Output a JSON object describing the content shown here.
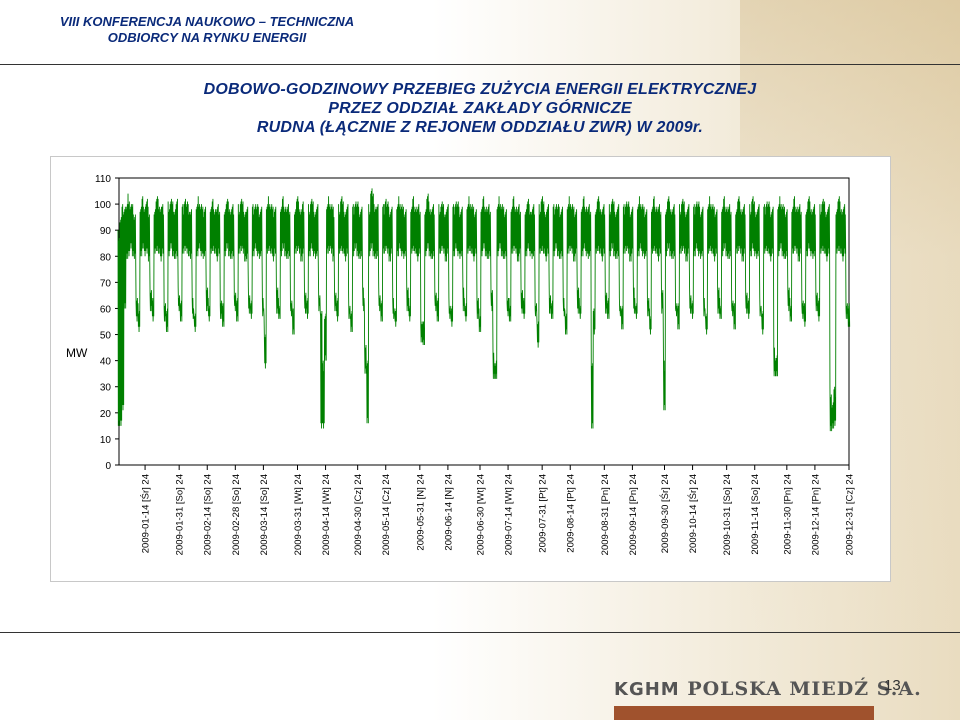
{
  "header": {
    "conference_line1": "VIII KONFERENCJA NAUKOWO – TECHNICZNA",
    "conference_line2": "ODBIORCY NA RYNKU ENERGII"
  },
  "slide_title": {
    "line1": "DOBOWO-GODZINOWY PRZEBIEG ZUŻYCIA ENERGII ELEKTRYCZNEJ",
    "line2": "PRZEZ ODDZIAŁ ZAKŁADY GÓRNICZE",
    "line3": "RUDNA (ŁĄCZNIE Z REJONEM ODDZIAŁU ZWR) W 2009r."
  },
  "footer": {
    "logo_kghm": "KGHM",
    "logo_rest": "POLSKA MIEDŹ S.A.",
    "page_number": "13"
  },
  "colors": {
    "title_blue": "#0a2a7a",
    "series_green": "#008000",
    "logo_bar": "#a0522d"
  },
  "chart_data": {
    "type": "line",
    "title": "",
    "xlabel": "",
    "ylabel": "MW",
    "ylim": [
      0,
      110
    ],
    "yticks": [
      0,
      10,
      20,
      30,
      40,
      50,
      60,
      70,
      80,
      90,
      100,
      110
    ],
    "grid": false,
    "series_color": "#008000",
    "x_tick_labels": [
      "2009-01-14 [Śr] 24",
      "2009-01-31 [So] 24",
      "2009-02-14 [So] 24",
      "2009-02-28 [So] 24",
      "2009-03-14 [So] 24",
      "2009-03-31 [Wt] 24",
      "2009-04-14 [Wt] 24",
      "2009-04-30 [Cz] 24",
      "2009-05-14 [Cz] 24",
      "2009-05-31 [N] 24",
      "2009-06-14 [N] 24",
      "2009-06-30 [Wt] 24",
      "2009-07-14 [Wt] 24",
      "2009-07-31 [Pt] 24",
      "2009-08-14 [Pt] 24",
      "2009-08-31 [Pn] 24",
      "2009-09-14 [Pn] 24",
      "2009-09-30 [Śr] 24",
      "2009-10-14 [Śr] 24",
      "2009-10-31 [So] 24",
      "2009-11-14 [So] 24",
      "2009-11-30 [Pn] 24",
      "2009-12-14 [Pn] 24",
      "2009-12-31 [Cz] 24"
    ],
    "x_tick_days": [
      14,
      31,
      45,
      59,
      73,
      90,
      104,
      120,
      134,
      151,
      165,
      181,
      195,
      212,
      226,
      243,
      257,
      273,
      287,
      304,
      318,
      334,
      348,
      365
    ],
    "x_range_days": [
      1,
      365
    ],
    "series": [
      {
        "note_days": "daily min / max load (MW) per day of 2009; day 1 = 2009-01-01",
        "x": [
          1,
          2,
          3,
          4,
          5,
          6,
          7,
          8,
          9,
          10,
          11,
          12,
          13,
          14,
          15,
          16,
          17,
          18,
          19,
          20,
          21,
          22,
          23,
          24,
          25,
          26,
          27,
          28,
          29,
          30,
          31,
          32,
          33,
          34,
          35,
          36,
          37,
          38,
          39,
          40,
          41,
          42,
          43,
          44,
          45,
          46,
          47,
          48,
          49,
          50,
          51,
          52,
          53,
          54,
          55,
          56,
          57,
          58,
          59,
          60,
          61,
          62,
          63,
          64,
          65,
          66,
          67,
          68,
          69,
          70,
          71,
          72,
          73,
          74,
          75,
          76,
          77,
          78,
          79,
          80,
          81,
          82,
          83,
          84,
          85,
          86,
          87,
          88,
          89,
          90,
          91,
          92,
          93,
          94,
          95,
          96,
          97,
          98,
          99,
          100,
          101,
          102,
          103,
          104,
          105,
          106,
          107,
          108,
          109,
          110,
          111,
          112,
          113,
          114,
          115,
          116,
          117,
          118,
          119,
          120,
          121,
          122,
          123,
          124,
          125,
          126,
          127,
          128,
          129,
          130,
          131,
          132,
          133,
          134,
          135,
          136,
          137,
          138,
          139,
          140,
          141,
          142,
          143,
          144,
          145,
          146,
          147,
          148,
          149,
          150,
          151,
          152,
          153,
          154,
          155,
          156,
          157,
          158,
          159,
          160,
          161,
          162,
          163,
          164,
          165,
          166,
          167,
          168,
          169,
          170,
          171,
          172,
          173,
          174,
          175,
          176,
          177,
          178,
          179,
          180,
          181,
          182,
          183,
          184,
          185,
          186,
          187,
          188,
          189,
          190,
          191,
          192,
          193,
          194,
          195,
          196,
          197,
          198,
          199,
          200,
          201,
          202,
          203,
          204,
          205,
          206,
          207,
          208,
          209,
          210,
          211,
          212,
          213,
          214,
          215,
          216,
          217,
          218,
          219,
          220,
          221,
          222,
          223,
          224,
          225,
          226,
          227,
          228,
          229,
          230,
          231,
          232,
          233,
          234,
          235,
          236,
          237,
          238,
          239,
          240,
          241,
          242,
          243,
          244,
          245,
          246,
          247,
          248,
          249,
          250,
          251,
          252,
          253,
          254,
          255,
          256,
          257,
          258,
          259,
          260,
          261,
          262,
          263,
          264,
          265,
          266,
          267,
          268,
          269,
          270,
          271,
          272,
          273,
          274,
          275,
          276,
          277,
          278,
          279,
          280,
          281,
          282,
          283,
          284,
          285,
          286,
          287,
          288,
          289,
          290,
          291,
          292,
          293,
          294,
          295,
          296,
          297,
          298,
          299,
          300,
          301,
          302,
          303,
          304,
          305,
          306,
          307,
          308,
          309,
          310,
          311,
          312,
          313,
          314,
          315,
          316,
          317,
          318,
          319,
          320,
          321,
          322,
          323,
          324,
          325,
          326,
          327,
          328,
          329,
          330,
          331,
          332,
          333,
          334,
          335,
          336,
          337,
          338,
          339,
          340,
          341,
          342,
          343,
          344,
          345,
          346,
          347,
          348,
          349,
          350,
          351,
          352,
          353,
          354,
          355,
          356,
          357,
          358,
          359,
          360,
          361,
          362,
          363,
          364,
          365
        ],
        "min": [
          14,
          15,
          20,
          60,
          78,
          80,
          82,
          80,
          78,
          55,
          50,
          80,
          82,
          80,
          80,
          78,
          58,
          55,
          80,
          82,
          80,
          78,
          80,
          55,
          50,
          80,
          82,
          80,
          78,
          80,
          58,
          55,
          80,
          82,
          80,
          80,
          78,
          56,
          50,
          80,
          82,
          80,
          78,
          80,
          58,
          55,
          80,
          82,
          80,
          78,
          80,
          56,
          52,
          80,
          82,
          80,
          78,
          80,
          58,
          55,
          80,
          82,
          80,
          78,
          78,
          58,
          55,
          80,
          82,
          80,
          78,
          80,
          56,
          37,
          80,
          82,
          80,
          78,
          80,
          58,
          55,
          80,
          82,
          80,
          78,
          80,
          56,
          50,
          80,
          82,
          80,
          78,
          80,
          58,
          55,
          80,
          82,
          80,
          78,
          80,
          58,
          14,
          13,
          40,
          80,
          82,
          80,
          78,
          58,
          55,
          80,
          82,
          80,
          78,
          80,
          56,
          50,
          80,
          82,
          80,
          78,
          80,
          58,
          35,
          15,
          80,
          82,
          80,
          78,
          80,
          58,
          55,
          80,
          82,
          80,
          78,
          80,
          56,
          52,
          80,
          82,
          80,
          78,
          80,
          58,
          55,
          80,
          82,
          80,
          78,
          80,
          47,
          45,
          80,
          82,
          80,
          78,
          80,
          58,
          55,
          80,
          82,
          80,
          78,
          80,
          56,
          52,
          80,
          82,
          80,
          78,
          80,
          58,
          55,
          80,
          82,
          80,
          78,
          80,
          56,
          50,
          80,
          82,
          80,
          78,
          80,
          58,
          33,
          32,
          80,
          82,
          80,
          78,
          80,
          56,
          55,
          80,
          82,
          80,
          78,
          80,
          58,
          55,
          80,
          82,
          80,
          78,
          80,
          56,
          45,
          80,
          82,
          80,
          78,
          80,
          58,
          55,
          80,
          82,
          80,
          78,
          80,
          56,
          50,
          80,
          82,
          80,
          78,
          80,
          58,
          55,
          80,
          82,
          80,
          78,
          80,
          13,
          50,
          80,
          82,
          80,
          78,
          80,
          58,
          55,
          80,
          82,
          80,
          78,
          80,
          56,
          52,
          80,
          82,
          80,
          78,
          80,
          58,
          55,
          80,
          82,
          80,
          78,
          80,
          56,
          50,
          80,
          82,
          80,
          78,
          80,
          58,
          20,
          80,
          82,
          80,
          78,
          80,
          56,
          52,
          80,
          82,
          80,
          78,
          80,
          58,
          55,
          80,
          82,
          80,
          78,
          80,
          56,
          50,
          80,
          82,
          80,
          78,
          80,
          58,
          55,
          80,
          82,
          80,
          78,
          80,
          56,
          52,
          80,
          82,
          80,
          78,
          80,
          58,
          55,
          80,
          82,
          80,
          78,
          80,
          56,
          50,
          80,
          82,
          80,
          78,
          80,
          34,
          33,
          80,
          82,
          80,
          78,
          80,
          58,
          55,
          80,
          82,
          80,
          78,
          80,
          56,
          52,
          80,
          82,
          80,
          78,
          80,
          58,
          55,
          80,
          82,
          80,
          78,
          80,
          13,
          13,
          15,
          80,
          82,
          80,
          78,
          80,
          56,
          52,
          80,
          82,
          80,
          78,
          80,
          58,
          55,
          80,
          82,
          80,
          78,
          80,
          13,
          13,
          13,
          15,
          80,
          82,
          80,
          60,
          14
        ],
        "max": [
          90,
          96,
          100,
          101,
          100,
          104,
          101,
          100,
          98,
          64,
          62,
          100,
          103,
          101,
          102,
          99,
          68,
          64,
          100,
          103,
          102,
          100,
          100,
          64,
          60,
          101,
          103,
          101,
          100,
          102,
          68,
          64,
          100,
          104,
          101,
          100,
          99,
          64,
          60,
          100,
          103,
          101,
          99,
          101,
          68,
          64,
          100,
          102,
          100,
          99,
          100,
          64,
          62,
          100,
          102,
          101,
          99,
          100,
          68,
          64,
          100,
          103,
          101,
          99,
          99,
          68,
          64,
          100,
          102,
          100,
          99,
          100,
          64,
          52,
          100,
          103,
          101,
          99,
          101,
          68,
          64,
          100,
          103,
          101,
          99,
          100,
          64,
          60,
          100,
          103,
          101,
          99,
          101,
          68,
          64,
          100,
          103,
          101,
          99,
          100,
          68,
          60,
          40,
          60,
          100,
          103,
          101,
          99,
          68,
          64,
          100,
          104,
          101,
          99,
          100,
          64,
          60,
          100,
          103,
          101,
          99,
          100,
          68,
          48,
          40,
          100,
          107,
          104,
          101,
          100,
          68,
          64,
          100,
          104,
          101,
          99,
          100,
          64,
          62,
          100,
          103,
          101,
          99,
          100,
          68,
          64,
          100,
          103,
          101,
          99,
          100,
          56,
          55,
          100,
          104,
          101,
          99,
          100,
          68,
          64,
          100,
          102,
          100,
          99,
          100,
          64,
          62,
          100,
          103,
          101,
          99,
          100,
          68,
          64,
          100,
          103,
          101,
          99,
          100,
          64,
          60,
          100,
          103,
          101,
          99,
          100,
          68,
          43,
          42,
          100,
          103,
          101,
          99,
          100,
          64,
          64,
          100,
          103,
          101,
          99,
          100,
          68,
          64,
          100,
          102,
          100,
          99,
          100,
          64,
          55,
          100,
          104,
          101,
          99,
          100,
          68,
          64,
          100,
          102,
          100,
          99,
          100,
          64,
          60,
          100,
          103,
          101,
          99,
          100,
          68,
          64,
          100,
          103,
          101,
          99,
          100,
          40,
          60,
          100,
          103,
          101,
          99,
          100,
          68,
          64,
          100,
          103,
          101,
          99,
          100,
          64,
          62,
          100,
          103,
          101,
          99,
          100,
          68,
          64,
          100,
          103,
          101,
          99,
          100,
          64,
          60,
          100,
          103,
          101,
          99,
          100,
          68,
          40,
          100,
          103,
          101,
          99,
          100,
          64,
          62,
          100,
          103,
          101,
          99,
          100,
          68,
          64,
          100,
          103,
          101,
          99,
          100,
          64,
          60,
          100,
          103,
          101,
          99,
          100,
          68,
          64,
          100,
          103,
          101,
          99,
          100,
          64,
          62,
          100,
          103,
          101,
          99,
          100,
          68,
          64,
          100,
          104,
          101,
          99,
          100,
          64,
          60,
          100,
          103,
          101,
          99,
          100,
          45,
          44,
          100,
          103,
          101,
          99,
          100,
          68,
          64,
          100,
          103,
          101,
          99,
          100,
          64,
          62,
          100,
          103,
          101,
          99,
          100,
          68,
          64,
          100,
          103,
          101,
          99,
          100,
          30,
          25,
          30,
          100,
          103,
          101,
          99,
          100,
          64,
          62,
          100,
          103,
          101,
          99,
          100,
          68,
          64,
          100,
          103,
          101,
          99,
          100,
          30,
          25,
          22,
          30,
          100,
          103,
          101,
          100,
          60
        ]
      }
    ]
  }
}
